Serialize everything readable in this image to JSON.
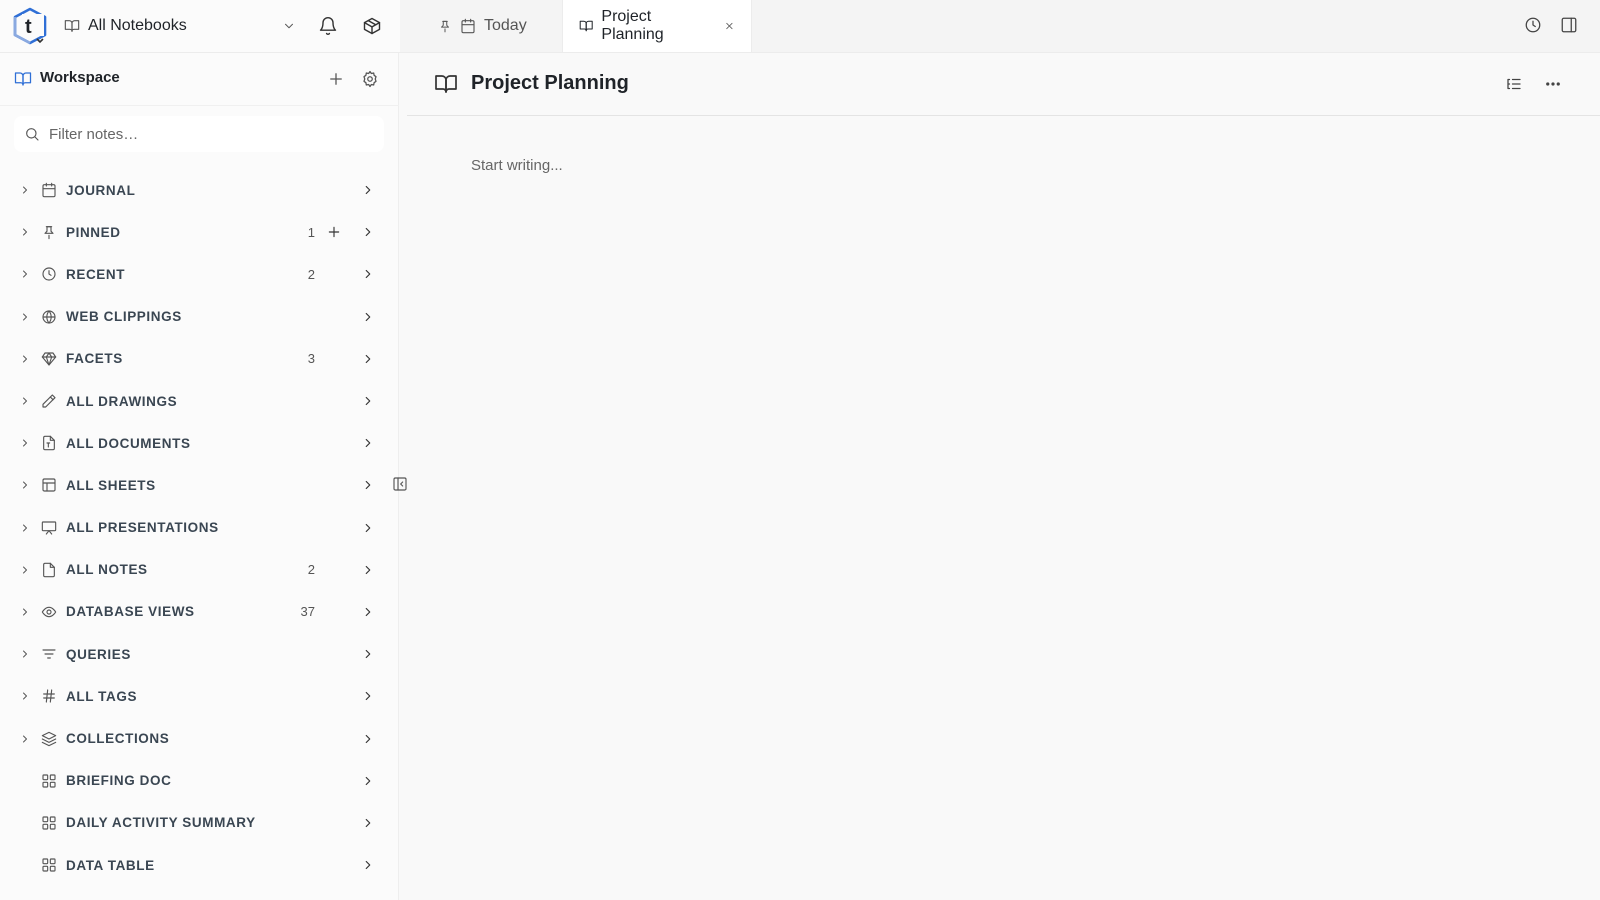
{
  "topbar": {
    "notebook_switcher": "All Notebooks",
    "tabs": [
      {
        "label": "Today",
        "icons": [
          "pin-icon",
          "calendar-icon"
        ]
      },
      {
        "label": "Project Planning",
        "icon": "book-icon",
        "active": true
      }
    ]
  },
  "sidebar": {
    "workspace_title": "Workspace",
    "filter_placeholder": "Filter notes…",
    "items": [
      {
        "label": "JOURNAL",
        "count": "",
        "icon": "calendar-icon"
      },
      {
        "label": "PINNED",
        "count": "1",
        "icon": "pin-icon"
      },
      {
        "label": "RECENT",
        "count": "2",
        "icon": "clock-icon"
      },
      {
        "label": "WEB CLIPPINGS",
        "count": "",
        "icon": "globe-icon"
      },
      {
        "label": "FACETS",
        "count": "3",
        "icon": "gem-icon"
      },
      {
        "label": "ALL DRAWINGS",
        "count": "",
        "icon": "pencil-icon"
      },
      {
        "label": "ALL DOCUMENTS",
        "count": "",
        "icon": "document-icon"
      },
      {
        "label": "ALL SHEETS",
        "count": "",
        "icon": "sheet-icon"
      },
      {
        "label": "ALL PRESENTATIONS",
        "count": "",
        "icon": "presentation-icon"
      },
      {
        "label": "ALL NOTES",
        "count": "2",
        "icon": "note-icon"
      },
      {
        "label": "DATABASE VIEWS",
        "count": "37",
        "icon": "eye-icon"
      },
      {
        "label": "QUERIES",
        "count": "",
        "icon": "filter-icon"
      },
      {
        "label": "ALL TAGS",
        "count": "",
        "icon": "hash-icon"
      },
      {
        "label": "COLLECTIONS",
        "count": "",
        "icon": "layers-icon"
      },
      {
        "label": "BRIEFING DOC",
        "count": "",
        "icon": "grid-icon"
      },
      {
        "label": "DAILY ACTIVITY SUMMARY",
        "count": "",
        "icon": "grid-icon"
      },
      {
        "label": "DATA TABLE",
        "count": "",
        "icon": "grid-icon"
      }
    ]
  },
  "main": {
    "doc_title": "Project Planning",
    "editor_placeholder": "Start writing..."
  },
  "colors": {
    "accent": "#2f6fd6",
    "label": "#3a4652"
  }
}
